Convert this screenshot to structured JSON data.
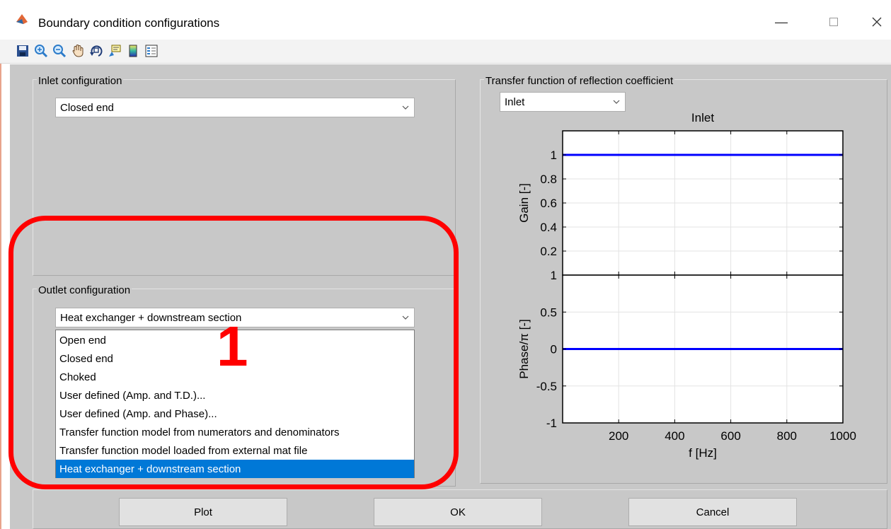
{
  "window": {
    "title": "Boundary condition configurations"
  },
  "toolbar": {
    "icons": [
      "save-icon",
      "zoom-in-icon",
      "zoom-out-icon",
      "pan-hand-icon",
      "rotate-3d-icon",
      "data-cursor-icon",
      "colorbar-icon",
      "legend-icon"
    ]
  },
  "inlet": {
    "label": "Inlet configuration",
    "selected": "Closed end"
  },
  "outlet": {
    "label": "Outlet configuration",
    "selected": "Heat exchanger + downstream section",
    "options": [
      "Open end",
      "Closed end",
      "Choked",
      "User defined (Amp. and T.D.)...",
      "User defined (Amp. and Phase)...",
      "Transfer function model from numerators and denominators",
      "Transfer function model loaded from external mat file",
      "Heat exchanger + downstream section"
    ]
  },
  "transfer": {
    "label": "Transfer function of reflection coefficient",
    "selected": "Inlet"
  },
  "annotation": {
    "marker": "1",
    "color": "#ff0000"
  },
  "buttons": {
    "plot": "Plot",
    "ok": "OK",
    "cancel": "Cancel"
  },
  "colors": {
    "figure_bg": "#c8c8c8",
    "selection": "#0078d7",
    "plot_line": "#0000ff"
  },
  "chart_data": {
    "type": "line",
    "title": "Inlet",
    "xlabel": "f [Hz]",
    "xlim": [
      0,
      1000
    ],
    "xticks": [
      200,
      400,
      600,
      800,
      1000
    ],
    "grid": true,
    "subplots": [
      {
        "ylabel": "Gain [-]",
        "ylim": [
          0,
          1.2
        ],
        "yticks": [
          0.2,
          0.4,
          0.6,
          0.8,
          1
        ],
        "ytick_labels": [
          "0.2",
          "0.4",
          "0.6",
          "0.8",
          "1"
        ],
        "series": [
          {
            "x": [
              0,
              1000
            ],
            "y": [
              1,
              1
            ]
          }
        ]
      },
      {
        "ylabel": "Phase/π [-]",
        "ylim": [
          -1,
          1
        ],
        "yticks": [
          -1,
          -0.5,
          0,
          0.5,
          1
        ],
        "ytick_labels": [
          "-1",
          "-0.5",
          "0",
          "0.5",
          "1"
        ],
        "series": [
          {
            "x": [
              0,
              1000
            ],
            "y": [
              0,
              0
            ]
          }
        ]
      }
    ]
  }
}
